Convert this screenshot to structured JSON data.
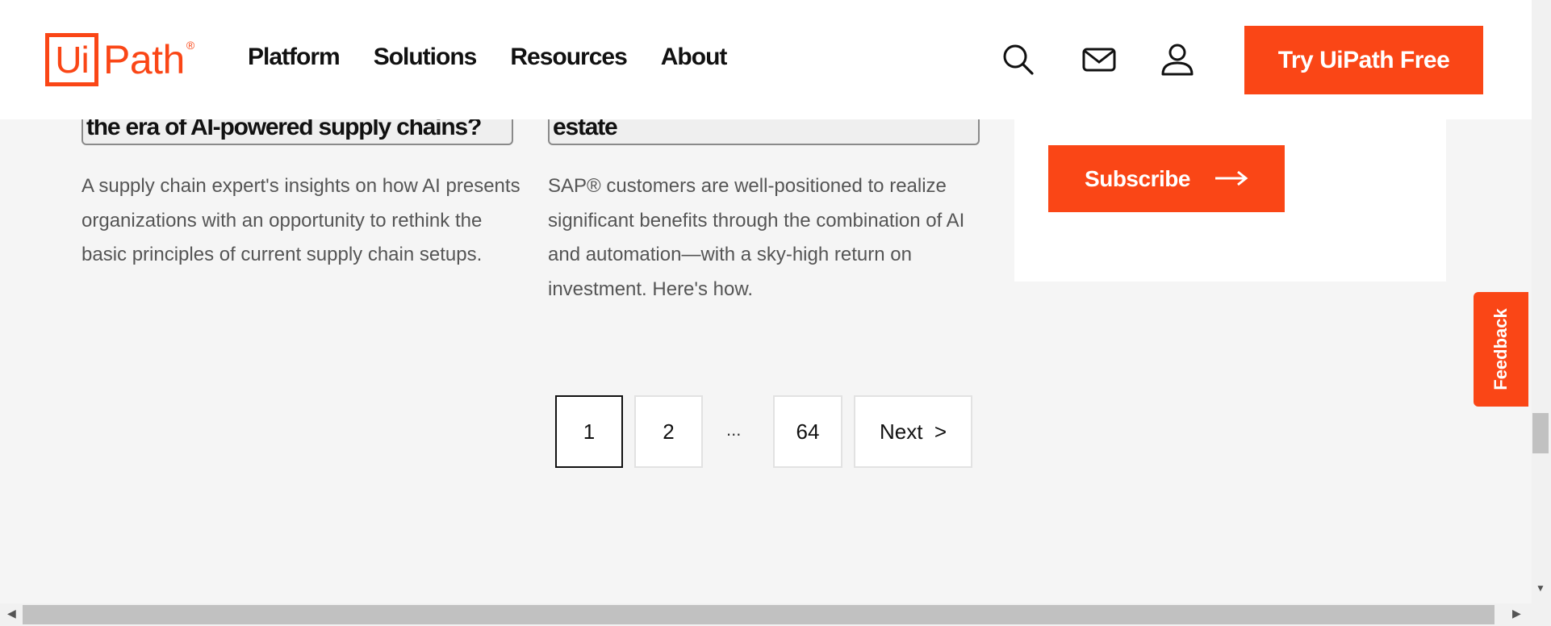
{
  "header": {
    "logo": {
      "box_text": "Ui",
      "text": "Path",
      "reg": "®"
    },
    "nav": [
      "Platform",
      "Solutions",
      "Resources",
      "About"
    ],
    "icons": [
      "search-icon",
      "mail-icon",
      "user-icon"
    ],
    "cta_label": "Try UiPath Free"
  },
  "cards": [
    {
      "title": "the era of AI-powered supply chains?",
      "description": "A supply chain expert's insights on how AI presents organizations with an opportunity to rethink the basic principles of current supply chain setups."
    },
    {
      "title": "estate",
      "description": "SAP® customers are well-positioned to realize significant benefits through the combination of AI and automation—with a sky-high return on investment. Here's how."
    }
  ],
  "subscribe": {
    "label": "Subscribe",
    "arrow": "⟶"
  },
  "pagination": {
    "pages": [
      "1",
      "2",
      "64"
    ],
    "ellipsis": "...",
    "next_label": "Next  >",
    "current": "1"
  },
  "feedback_label": "Feedback",
  "colors": {
    "brand": "#fa4616",
    "background": "#f5f5f5"
  }
}
